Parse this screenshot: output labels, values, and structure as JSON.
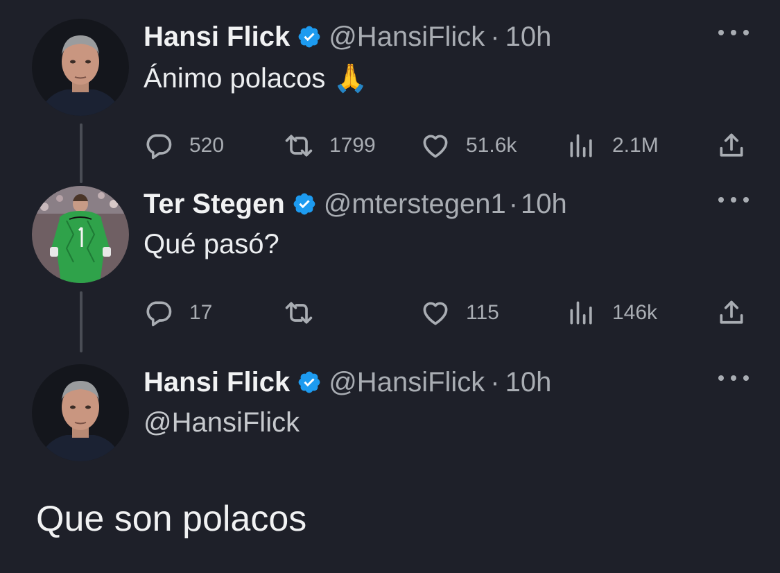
{
  "tweets": [
    {
      "name": "Hansi Flick",
      "handle": "@HansiFlick",
      "separator": "·",
      "time": "10h",
      "text": "Ánimo polacos 🙏",
      "replies": "520",
      "retweets": "1799",
      "likes": "51.6k",
      "views": "2.1M"
    },
    {
      "name": "Ter Stegen",
      "handle": "@mterstegen1",
      "separator": "·",
      "time": "10h",
      "text": "Qué pasó?",
      "replies": "17",
      "retweets": "",
      "likes": "115",
      "views": "146k"
    },
    {
      "name": "Hansi Flick",
      "handle": "@HansiFlick",
      "separator": "·",
      "time": "10h",
      "text": "@HansiFlick"
    }
  ],
  "caption": "Que son polacos",
  "colors": {
    "background": "#1e2029",
    "text_primary": "#f1f2f3",
    "text_secondary": "#a9adb3",
    "verified_badge": "#1d9bf0",
    "thread_line": "#4a4d55"
  },
  "icons": {
    "reply": "reply-icon",
    "retweet": "retweet-icon",
    "like": "like-icon",
    "views": "views-icon",
    "share": "share-icon",
    "verified": "verified-badge-icon",
    "more": "more-options-icon"
  }
}
